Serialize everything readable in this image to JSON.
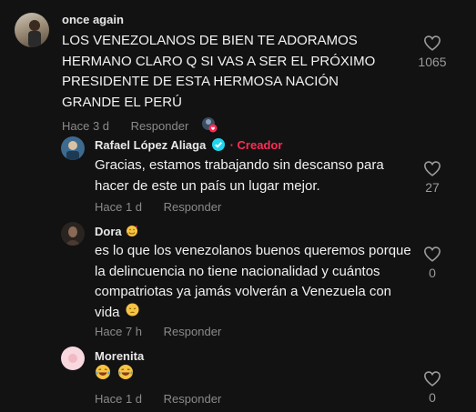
{
  "comments": [
    {
      "username": "once again",
      "text": "LOS VENEZOLANOS DE BIEN TE ADORAMOS HERMANO CLARO Q SI VAS A SER EL PRÓXIMO PRESIDENTE DE ESTA HERMOSA NACIÓN GRANDE EL PERÚ",
      "time": "Hace 3 d",
      "reply": "Responder",
      "likes": "1065"
    },
    {
      "username": "Rafael López Aliaga",
      "badge": "Creador",
      "text": "Gracias, estamos trabajando sin descanso para hacer de este un país un lugar mejor.",
      "time": "Hace 1 d",
      "reply": "Responder",
      "likes": "27"
    },
    {
      "username": "Dora",
      "text": "es lo que los venezolanos buenos queremos porque la delincuencia no tiene nacionalidad y cuántos compatriotas ya jamás volverán a Venezuela con vida",
      "time": "Hace 7 h",
      "reply": "Responder",
      "likes": "0"
    },
    {
      "username": "Morenita",
      "text": "",
      "time": "Hace 1 d",
      "reply": "Responder",
      "likes": "0"
    }
  ],
  "icons": {
    "like": "heart-outline-icon",
    "verified": "verified-check-icon",
    "creator_liked": "liked-by-creator-icon"
  },
  "colors": {
    "background": "#121212",
    "creator_badge": "#fe2c55",
    "verified": "#20d5ec"
  }
}
